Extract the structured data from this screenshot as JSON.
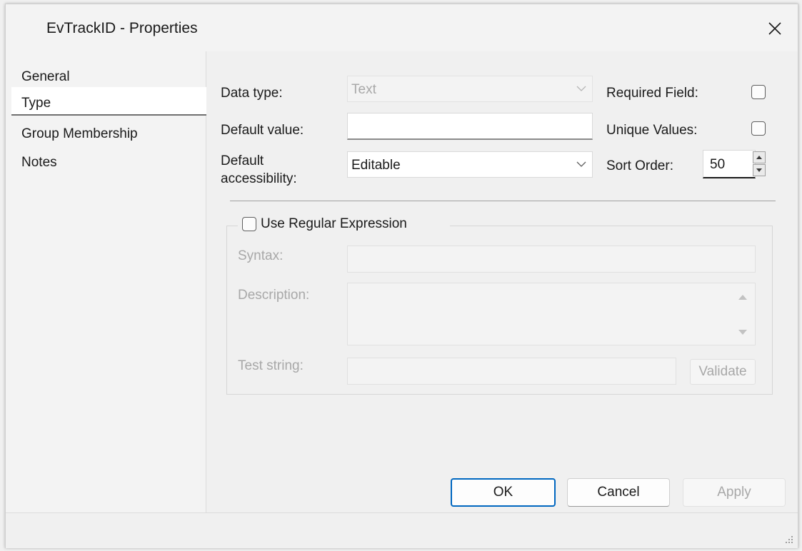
{
  "window": {
    "title": "EvTrackID - Properties"
  },
  "nav": {
    "items": [
      {
        "label": "General"
      },
      {
        "label": "Type"
      },
      {
        "label": "Group Membership"
      },
      {
        "label": "Notes"
      }
    ],
    "selected": "Type"
  },
  "form": {
    "data_type_label": "Data type:",
    "data_type_value": "Text",
    "default_value_label": "Default value:",
    "default_value": "",
    "default_accessibility_label_line1": "Default",
    "default_accessibility_label_line2": "accessibility:",
    "default_accessibility_value": "Editable",
    "required_field_label": "Required Field:",
    "required_field_checked": false,
    "unique_values_label": "Unique Values:",
    "unique_values_checked": false,
    "sort_order_label": "Sort Order:",
    "sort_order_value": "50"
  },
  "regex": {
    "use_label": "Use Regular Expression",
    "use_checked": false,
    "syntax_label": "Syntax:",
    "syntax_value": "",
    "description_label": "Description:",
    "description_value": "",
    "test_string_label": "Test string:",
    "test_string_value": "",
    "validate_label": "Validate"
  },
  "buttons": {
    "ok": "OK",
    "cancel": "Cancel",
    "apply": "Apply"
  },
  "colors": {
    "ok_border": "#0067c0",
    "disabled_text": "#a8a8a8"
  }
}
